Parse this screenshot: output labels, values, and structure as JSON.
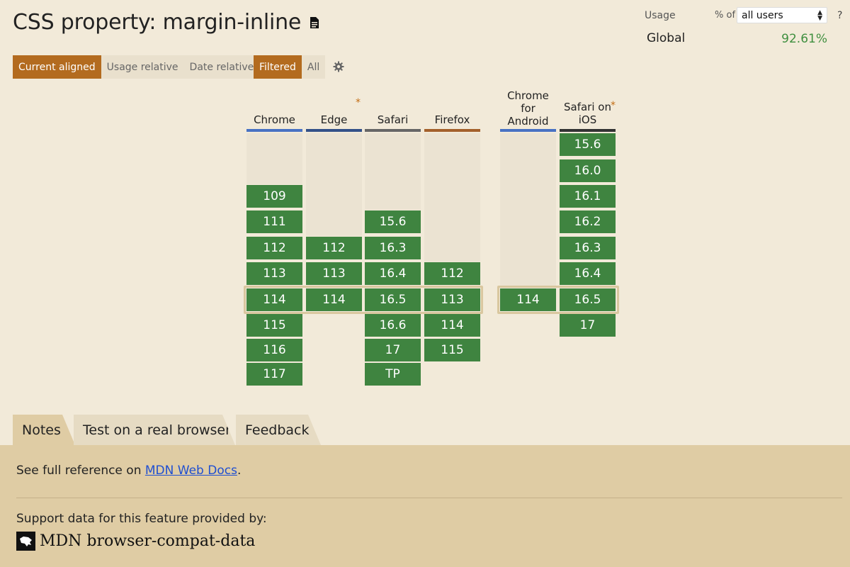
{
  "page": {
    "title": "CSS property: margin-inline"
  },
  "usage": {
    "label": "Usage",
    "pct_of": "% of",
    "users_select": "all users",
    "help": "?",
    "region": "Global",
    "value": "92.61%"
  },
  "view_buttons": {
    "current_aligned": "Current aligned",
    "usage_relative": "Usage relative",
    "date_relative": "Date relative"
  },
  "filter_buttons": {
    "filtered": "Filtered",
    "all": "All"
  },
  "colors": {
    "accent": "#b36b1f",
    "supported": "#3f8440",
    "chrome": "#4872c3",
    "edge": "#335188",
    "safari": "#666666",
    "firefox": "#a3602b",
    "ios": "#333333"
  },
  "browsers": [
    {
      "name": "Chrome",
      "star": "",
      "versions": [
        "109",
        "111",
        "112",
        "113",
        "114",
        "115",
        "116",
        "117"
      ]
    },
    {
      "name": "Edge",
      "star": "*",
      "versions": [
        "112",
        "113",
        "114"
      ]
    },
    {
      "name": "Safari",
      "star": "",
      "versions": [
        "15.6",
        "16.3",
        "16.4",
        "16.5",
        "16.6",
        "17",
        "TP"
      ]
    },
    {
      "name": "Firefox",
      "star": "",
      "versions": [
        "112",
        "113",
        "114",
        "115"
      ]
    },
    {
      "name": "Chrome for Android",
      "star": "",
      "versions": [
        "114"
      ]
    },
    {
      "name": "Safari on iOS",
      "star": "*",
      "versions": [
        "15.6",
        "16.0",
        "16.1",
        "16.2",
        "16.3",
        "16.4",
        "16.5",
        "17"
      ]
    }
  ],
  "tabs": {
    "notes": "Notes",
    "test": "Test on a real browser",
    "feedback": "Feedback"
  },
  "notes": {
    "ref_prefix": "See full reference on ",
    "ref_link": "MDN Web Docs",
    "ref_suffix": ".",
    "support_text": "Support data for this feature provided by:",
    "mdn_text": "MDN browser-compat-data"
  }
}
